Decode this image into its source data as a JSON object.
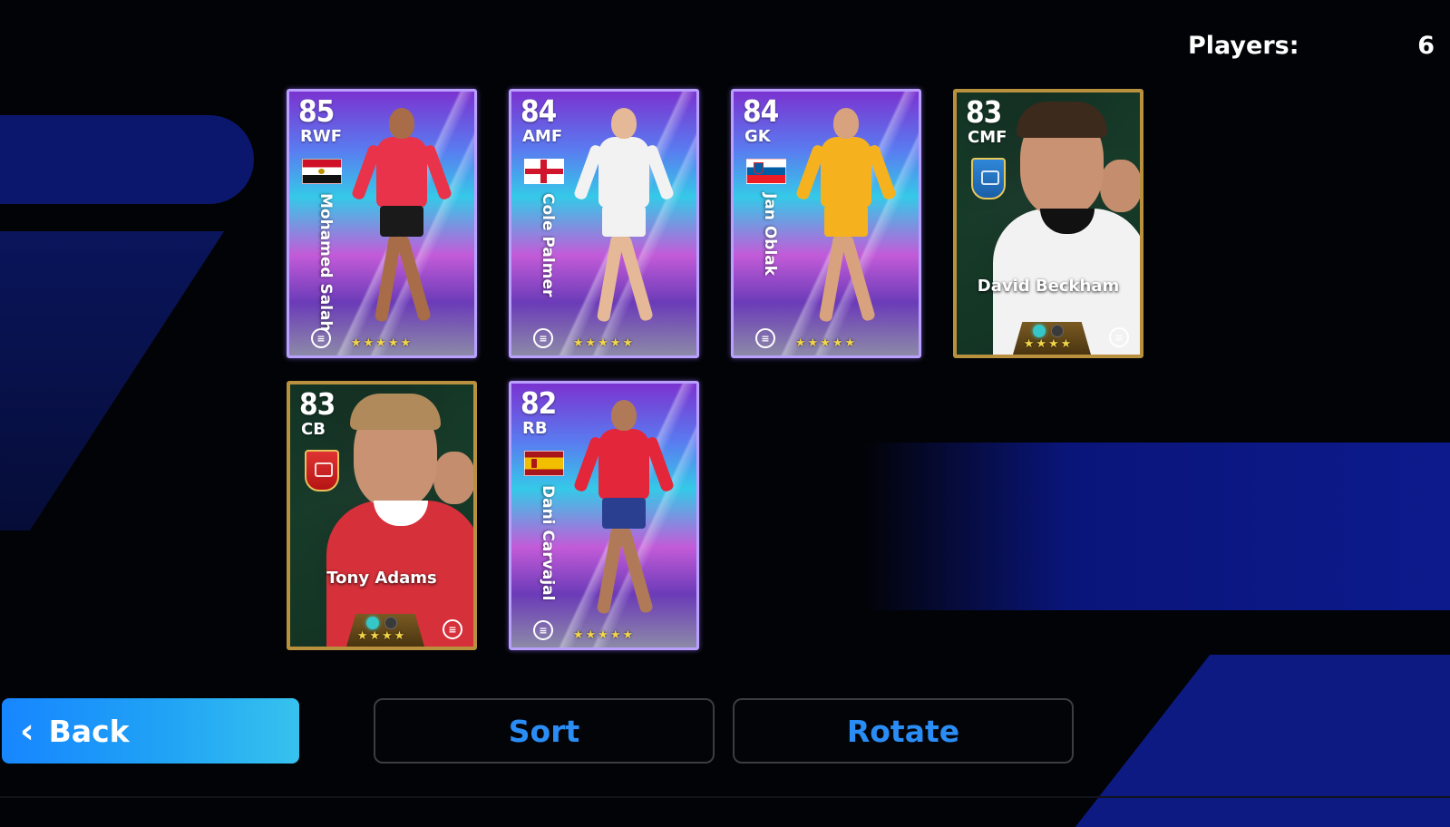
{
  "header": {
    "players_label": "Players:",
    "players_count": "6"
  },
  "cards": [
    {
      "rating": "85",
      "position": "RWF",
      "name": "Mohamed Salah",
      "style": "standard",
      "badge": "flag-egypt",
      "stars": "★★★★★",
      "kit": "#e8334a",
      "shorts": "#1a1a1a",
      "skin": "#a86c48"
    },
    {
      "rating": "84",
      "position": "AMF",
      "name": "Cole Palmer",
      "style": "standard",
      "badge": "flag-england",
      "stars": "★★★★★",
      "kit": "#f2f2f2",
      "shorts": "#f2f2f2",
      "skin": "#e5b897"
    },
    {
      "rating": "84",
      "position": "GK",
      "name": "Jan Oblak",
      "style": "standard",
      "badge": "flag-slovenia",
      "stars": "★★★★★",
      "kit": "#f5b21e",
      "shorts": "#f5b21e",
      "skin": "#d9a27e"
    },
    {
      "rating": "83",
      "position": "CMF",
      "name": "David Beckham",
      "style": "legend",
      "badge": "crest-blue",
      "stars": "★★★★",
      "kit": "#f2f2f2",
      "hair": "#3c2a1c",
      "collar": "#111111"
    },
    {
      "rating": "83",
      "position": "CB",
      "name": "Tony Adams",
      "style": "legend",
      "badge": "crest-red",
      "stars": "★★★★",
      "kit": "#d6303a",
      "hair": "#b08a5a",
      "collar": "#ffffff"
    },
    {
      "rating": "82",
      "position": "RB",
      "name": "Dani Carvajal",
      "style": "standard",
      "badge": "flag-spain",
      "stars": "★★★★★",
      "kit": "#e3263a",
      "shorts": "#2a3f8f",
      "skin": "#b07a58"
    }
  ],
  "buttons": {
    "back": "Back",
    "sort": "Sort",
    "rotate": "Rotate"
  },
  "icons": {
    "back": "chevron-left-icon",
    "efootball": "efootball-logo-icon"
  },
  "colors": {
    "accent": "#2a8df5",
    "back_button": "#1786ff",
    "background": "#020306"
  }
}
